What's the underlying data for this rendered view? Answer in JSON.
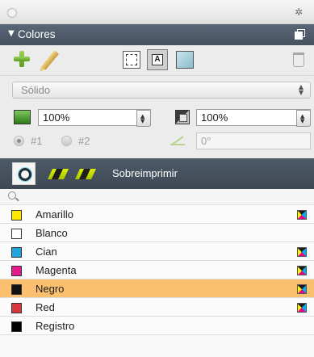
{
  "panel": {
    "title": "Colores"
  },
  "toolbar": {},
  "fill_type": {
    "selected": "Sólido"
  },
  "tint": {
    "fill_value": "100%",
    "stroke_value": "100%"
  },
  "gradient": {
    "option1": "#1",
    "option2": "#2",
    "angle": "0°"
  },
  "overprint": {
    "label": "Sobreimprimir"
  },
  "swatches": [
    {
      "name": "Amarillo",
      "color": "#ffe800",
      "process": true,
      "selected": false
    },
    {
      "name": "Blanco",
      "color": "#ffffff",
      "process": false,
      "selected": false
    },
    {
      "name": "Cian",
      "color": "#1ea6dc",
      "process": true,
      "selected": false
    },
    {
      "name": "Magenta",
      "color": "#e5198a",
      "process": true,
      "selected": false
    },
    {
      "name": "Negro",
      "color": "#111111",
      "process": true,
      "selected": true
    },
    {
      "name": "Red",
      "color": "#d8383b",
      "process": true,
      "selected": false
    },
    {
      "name": "Registro",
      "color": "#000000",
      "process": false,
      "selected": false
    }
  ]
}
